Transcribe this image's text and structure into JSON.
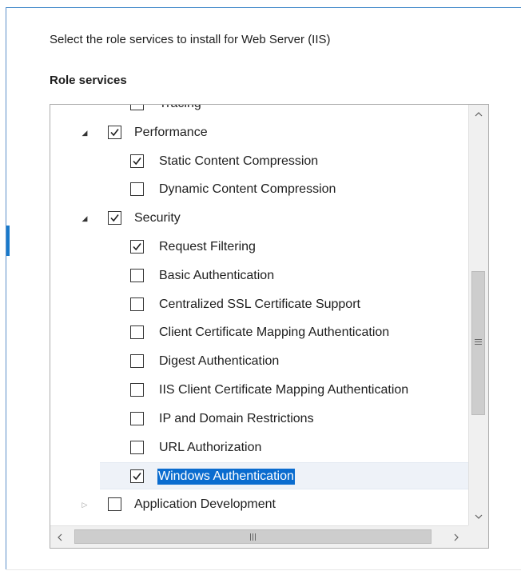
{
  "header": {
    "instruction": "Select the role services to install for Web Server (IIS)",
    "section_title": "Role services"
  },
  "tree": {
    "items": [
      {
        "label": "Tracing",
        "level": 2,
        "checked": false,
        "expander": "none"
      },
      {
        "label": "Performance",
        "level": 1,
        "checked": true,
        "expander": "expanded"
      },
      {
        "label": "Static Content Compression",
        "level": 2,
        "checked": true,
        "expander": "none"
      },
      {
        "label": "Dynamic Content Compression",
        "level": 2,
        "checked": false,
        "expander": "none"
      },
      {
        "label": "Security",
        "level": 1,
        "checked": true,
        "expander": "expanded"
      },
      {
        "label": "Request Filtering",
        "level": 2,
        "checked": true,
        "expander": "none"
      },
      {
        "label": "Basic Authentication",
        "level": 2,
        "checked": false,
        "expander": "none"
      },
      {
        "label": "Centralized SSL Certificate Support",
        "level": 2,
        "checked": false,
        "expander": "none"
      },
      {
        "label": "Client Certificate Mapping Authentication",
        "level": 2,
        "checked": false,
        "expander": "none"
      },
      {
        "label": "Digest Authentication",
        "level": 2,
        "checked": false,
        "expander": "none"
      },
      {
        "label": "IIS Client Certificate Mapping Authentication",
        "level": 2,
        "checked": false,
        "expander": "none"
      },
      {
        "label": "IP and Domain Restrictions",
        "level": 2,
        "checked": false,
        "expander": "none"
      },
      {
        "label": "URL Authorization",
        "level": 2,
        "checked": false,
        "expander": "none"
      },
      {
        "label": "Windows Authentication",
        "level": 2,
        "checked": true,
        "expander": "none",
        "selected": true
      },
      {
        "label": "Application Development",
        "level": 1,
        "checked": false,
        "expander": "collapsed"
      }
    ]
  },
  "scrollbars": {
    "vertical_up_icon": "chevron-up-icon",
    "vertical_down_icon": "chevron-down-icon",
    "horizontal_left_icon": "chevron-left-icon",
    "horizontal_right_icon": "chevron-right-icon"
  },
  "colors": {
    "selection": "#0a6ccf",
    "accent": "#1979ca"
  }
}
